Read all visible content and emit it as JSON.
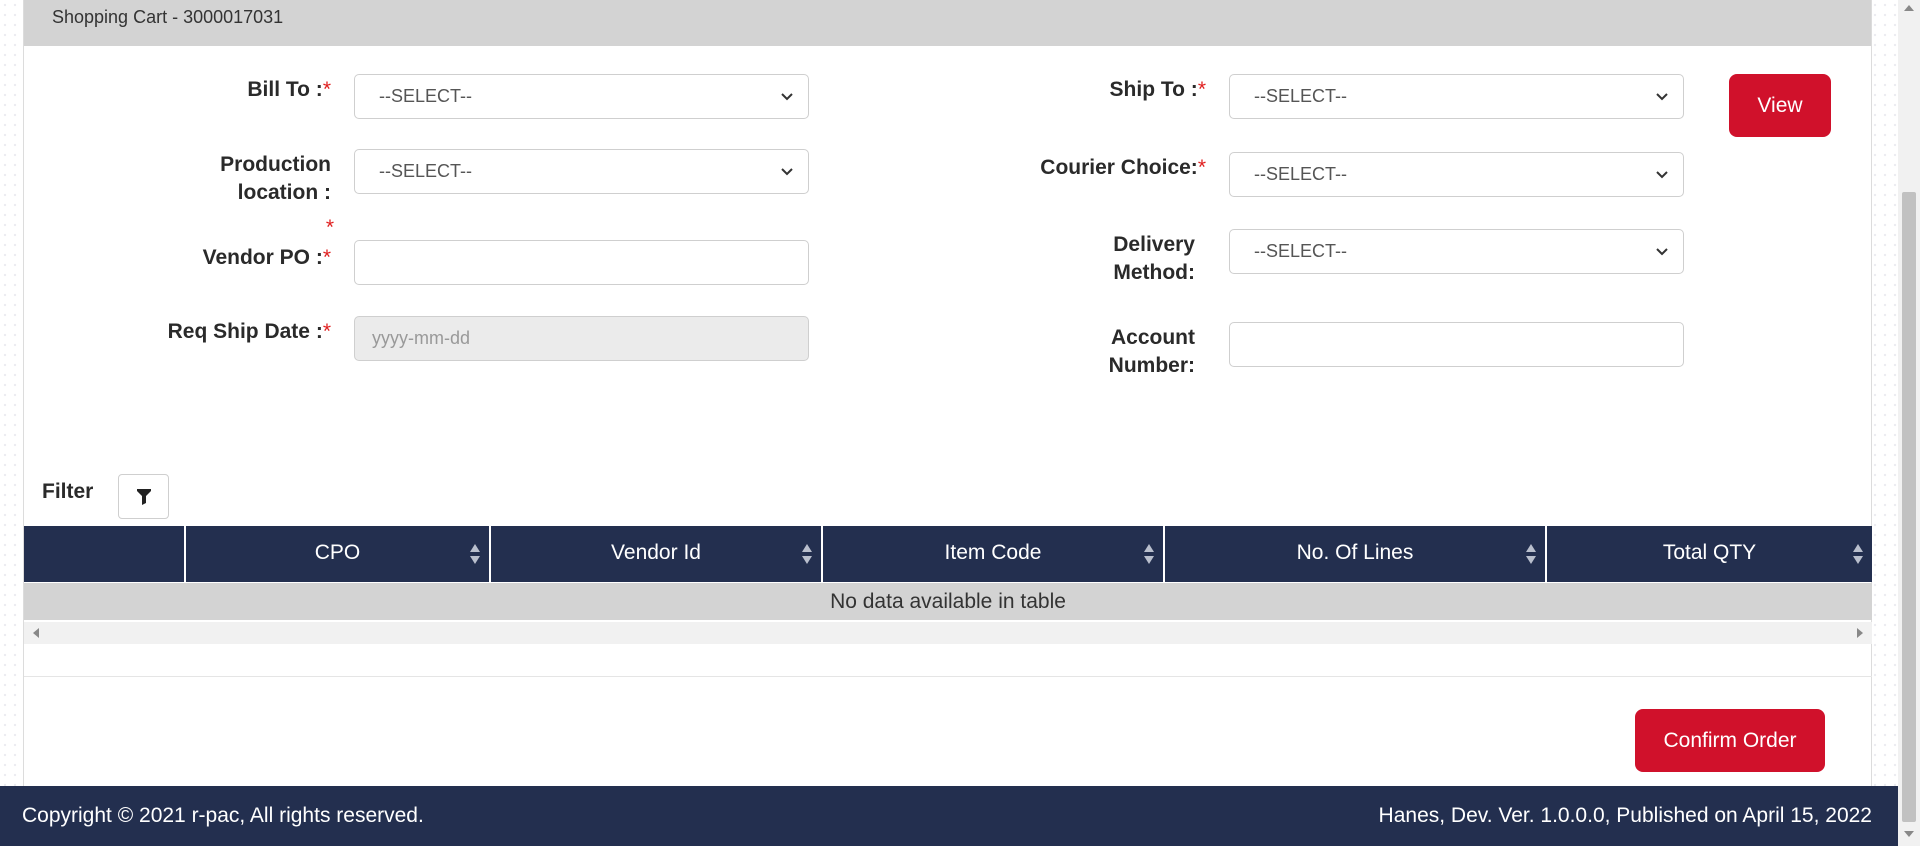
{
  "header": {
    "title": "Shopping Cart - 3000017031"
  },
  "form": {
    "bill_to": {
      "label": "Bill To :",
      "value": "--SELECT--"
    },
    "production_location": {
      "label_line1": "Production",
      "label_line2": "location :",
      "value": "--SELECT--"
    },
    "vendor_po": {
      "label": "Vendor PO :",
      "value": ""
    },
    "req_ship_date": {
      "label": "Req Ship Date :",
      "placeholder": "yyyy-mm-dd"
    },
    "ship_to": {
      "label": "Ship To :",
      "value": "--SELECT--"
    },
    "courier_choice": {
      "label": "Courier Choice:",
      "value": "--SELECT--"
    },
    "delivery_method": {
      "label_line1": "Delivery",
      "label_line2": "Method:",
      "value": "--SELECT--"
    },
    "account_number": {
      "label_line1": "Account",
      "label_line2": "Number:",
      "value": ""
    },
    "required_marker": "*"
  },
  "view_button": "View",
  "filter": {
    "label": "Filter"
  },
  "table": {
    "columns": [
      "",
      "CPO",
      "Vendor Id",
      "Item Code",
      "No. Of Lines",
      "Total QTY"
    ],
    "empty_message": "No data available in table"
  },
  "confirm_button": "Confirm Order",
  "footer": {
    "copyright": "Copyright © 2021 r-pac, All rights reserved.",
    "version": "Hanes, Dev. Ver. 1.0.0.0, Published on April 15, 2022"
  },
  "colors": {
    "navy": "#232f4f",
    "brand_red": "#d0112b",
    "required": "#e02020"
  }
}
